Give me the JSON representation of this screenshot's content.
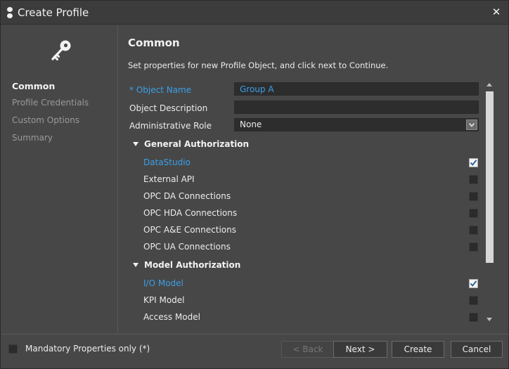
{
  "window": {
    "title": "Create Profile",
    "close_label": "✕"
  },
  "sidebar": {
    "items": [
      {
        "label": "Common",
        "active": true
      },
      {
        "label": "Profile Credentials",
        "active": false
      },
      {
        "label": "Custom Options",
        "active": false
      },
      {
        "label": "Summary",
        "active": false
      }
    ]
  },
  "main": {
    "section_title": "Common",
    "instruction": "Set properties for new Profile Object, and click next to Continue.",
    "fields": {
      "object_name": {
        "label": "* Object Name",
        "value": "Group A"
      },
      "object_description": {
        "label": "Object Description",
        "value": ""
      },
      "administrative_role": {
        "label": "Administrative Role",
        "value": "None"
      }
    },
    "groups": [
      {
        "label": "General Authorization",
        "items": [
          {
            "label": "DataStudio",
            "checked": true
          },
          {
            "label": "External API",
            "checked": false
          },
          {
            "label": "OPC DA Connections",
            "checked": false
          },
          {
            "label": "OPC HDA Connections",
            "checked": false
          },
          {
            "label": "OPC A&E Connections",
            "checked": false
          },
          {
            "label": "OPC UA Connections",
            "checked": false
          }
        ]
      },
      {
        "label": "Model Authorization",
        "items": [
          {
            "label": "I/O Model",
            "checked": true
          },
          {
            "label": "KPI Model",
            "checked": false
          },
          {
            "label": "Access Model",
            "checked": false
          }
        ]
      }
    ]
  },
  "footer": {
    "mandatory_only_label": "Mandatory Properties only (*)",
    "mandatory_only_checked": false,
    "buttons": {
      "back": "< Back",
      "next": "Next >",
      "create": "Create",
      "cancel": "Cancel"
    }
  },
  "colors": {
    "accent": "#3aa0e8",
    "background": "#474747",
    "input_background": "#2d2d2d"
  },
  "icons": {
    "title": "app-icon",
    "header": "key-icon",
    "close": "close-icon"
  }
}
